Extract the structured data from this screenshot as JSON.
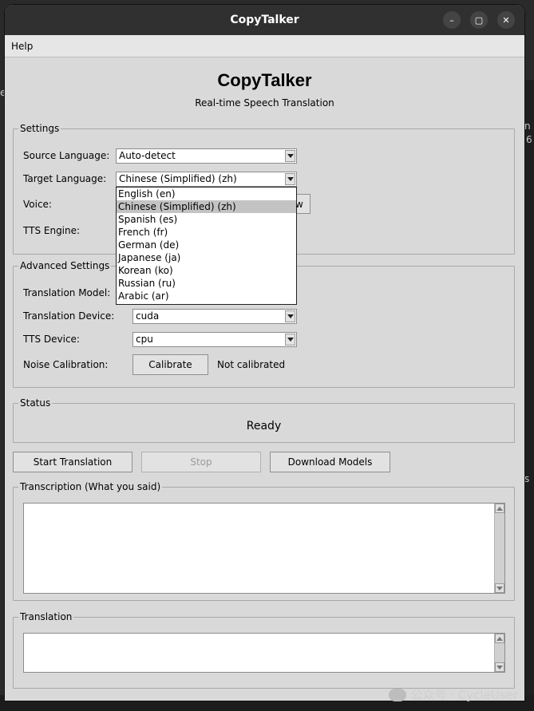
{
  "window": {
    "title": "CopyTalker"
  },
  "menu": {
    "help": "Help"
  },
  "header": {
    "title": "CopyTalker",
    "subtitle": "Real-time Speech Translation"
  },
  "settings": {
    "legend": "Settings",
    "source_language_label": "Source Language:",
    "source_language_value": "Auto-detect",
    "target_language_label": "Target Language:",
    "target_language_value": "Chinese (Simplified) (zh)",
    "voice_label": "Voice:",
    "tts_engine_label": "TTS Engine:",
    "target_language_options": [
      "English (en)",
      "Chinese (Simplified) (zh)",
      "Spanish (es)",
      "French (fr)",
      "German (de)",
      "Japanese (ja)",
      "Korean (ko)",
      "Russian (ru)",
      "Arabic (ar)"
    ],
    "selected_option_index": 1,
    "voice_button_partial": "w"
  },
  "advanced": {
    "legend": "Advanced Settings",
    "translation_model_label": "Translation Model:",
    "translation_device_label": "Translation Device:",
    "translation_device_value": "cuda",
    "tts_device_label": "TTS Device:",
    "tts_device_value": "cpu",
    "noise_calibration_label": "Noise Calibration:",
    "calibrate_button": "Calibrate",
    "calibration_status": "Not calibrated"
  },
  "status": {
    "legend": "Status",
    "value": "Ready"
  },
  "actions": {
    "start": "Start Translation",
    "stop": "Stop",
    "download": "Download Models"
  },
  "transcription": {
    "legend": "Transcription (What you said)"
  },
  "translation": {
    "legend": "Translation"
  },
  "background": {
    "right_text_1": "n",
    "right_text_2": "6",
    "left_text": "e",
    "right_text_3": "s"
  },
  "watermark": {
    "text": "公众号 · CycleUser"
  }
}
